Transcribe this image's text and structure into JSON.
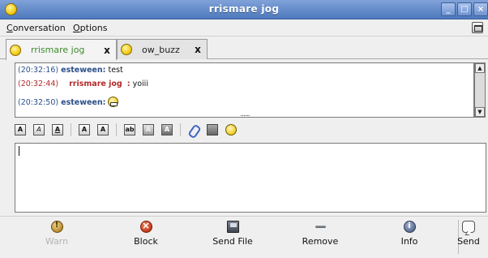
{
  "window": {
    "title": "rrismare jog",
    "buttons": {
      "minimize": "_",
      "maximize": "□",
      "close": "×"
    }
  },
  "menu": {
    "items": [
      {
        "label_underlined": "C",
        "label_rest": "onversation"
      },
      {
        "label_underlined": "O",
        "label_rest": "ptions"
      }
    ]
  },
  "tabs": [
    {
      "label": "rrismare jog",
      "close": "x",
      "active": true
    },
    {
      "label": "ow_buzz",
      "close": "x",
      "active": false
    }
  ],
  "conversation": {
    "messages": [
      {
        "timestamp": "(20:32:16)",
        "nick": "esteween:",
        "text": "test"
      },
      {
        "timestamp": "(20:32:44)",
        "nick": "rrismare jog",
        "sep": ":",
        "text": "yoiii"
      },
      {
        "timestamp": "(20:32:50)",
        "nick": "esteween:",
        "text": ""
      }
    ]
  },
  "resize_grip": "......",
  "format_toolbar": {
    "buttons": [
      "A",
      "A",
      "A",
      "A",
      "A",
      "ab",
      "A",
      "A"
    ]
  },
  "actions": {
    "warn": "Warn",
    "block": "Block",
    "send_file": "Send File",
    "remove": "Remove",
    "info": "Info",
    "send": "Send"
  },
  "colors": {
    "titlebar": "#4f79bd",
    "own_nick": "#2a4f8a",
    "buddy_nick": "#b52a2a",
    "active_tab_text": "#3c8a2c"
  }
}
